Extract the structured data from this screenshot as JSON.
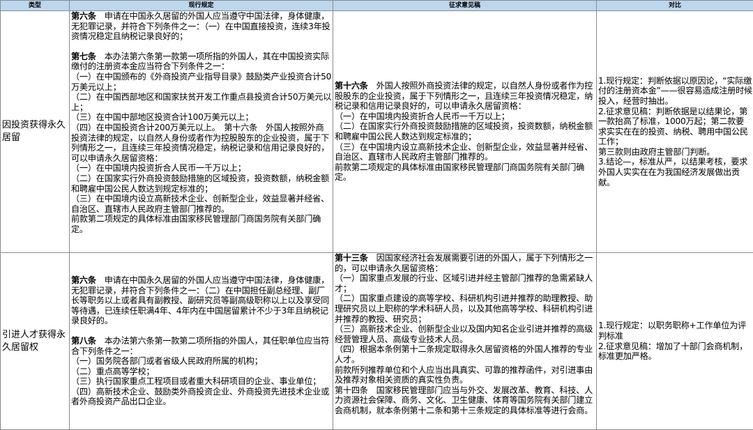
{
  "headers": [
    "类型",
    "现行规定",
    "征求意见稿",
    "对比"
  ],
  "rows": [
    {
      "type": "因投资获得永久居留",
      "current": [
        {
          "art": "第六条",
          "text": "　申请在中国永久居留的外国人应当遵守中国法律，身体健康，无犯罪记录，并符合下列条件之一：（一）在中国直接投资，连续3年投资情况稳定且纳税记录良好的；"
        },
        {
          "art": "第七条",
          "text": "　本办法第六条第一款第一项所指的外国人，其在中国投资实际缴付的注册资本金应当符合下列条件之一：\n（一）在中国颁布的《外商投资产业指导目录》鼓励类产业投资合计50万美元以上；\n（二）在中国西部地区和国家扶贫开发工作重点县投资合计50万美元以上；\n（三）在中国中部地区投资合计100万美元以上；\n（四）在中国投资合计200万美元以上。　第十六条　外国人按照外商投资法律的规定，以自然人身份或者作为控股股东的企业投资，属于下列情形之一，且连续三年投资情况稳定，纳税记录和信用记录良好的，可以申请永久居留资格：\n（一）在中国境内投资折合人民币一千万以上；\n（二）在国家实行外商投资鼓励措施的区域投资，投资数额，纳税金额和聘雇中国公民人数达到规定标准的；\n（三）在中国境内设立高新技术企业、创新型企业，效益显著并经省、自治区、直辖市人民政府主管部门推荐的。\n前款第二项规定的具体标准由国家移民管理部门商国务院有关部门确定。"
        }
      ],
      "draft": [
        {
          "art": "第十六条",
          "text": "　外国人按照外商投资法律的规定，以自然人身份或者作为控股股东的企业投资，属于下列情形之一，且连续三年投资情况稳定，纳税记录和信用记录良好的，可以申请永久居留资格：\n（一）在中国境内投资折合人民币一千万以上；\n（二）在国家实行外商投资鼓励措施的区域投资，投资数额，纳税金额和聘雇中国公民人数达到规定标准的；\n（三）在中国境内设立高新技术企业、创新型企业，效益显著并经省、自治区、直辖市人民政府主管部门推荐的。\n前款第二项规定的具体标准由国家移民管理部门商国务院有关部门确定。"
        }
      ],
      "compare": "1.现行规定：判断依据以原因论，“实际缴付的注册资本金”——很容易造成注册时候投入，经营时抽出。\n2.征求意见稿：判断依据是以结果论，第一款抬高了标准，1000万起；第二款要求实实在在的投资、纳税、聘用中国公民工作；\n第三款则由政府主管部门判断。\n3.结论—，标准从严，以结果考核，要求外国人实实在在为我国经济发展做出贡献。"
    },
    {
      "type": "引进人才获得永久居留权",
      "current": [
        {
          "art": "第六条",
          "text": "　申请在中国永久居留的外国人应当遵守中国法律，身体健康，无犯罪记录，并符合下列条件之一：（二）在中国担任副总经理、副厂长等职务以上或者具有副教授、副研究员等副高级职称以上以及享受同等待遇，已连续任职满4年、4年内在中国居留累计不少于3年且纳税记录良好的。"
        },
        {
          "art": "第八条",
          "text": "　本办法第六条第一款第二项所指的外国人，其任职单位应当符合下列条件之一：\n（一）国务院各部门或者省级人民政府所属的机构；\n（二）重点高等学校；\n（三）执行国家重点工程项目或者重大科研项目的企业、事业单位；\n（四）高新技术企业、鼓励类外商投资企业、外商投资先进技术企业或者外商投资产品出口企业。"
        }
      ],
      "draft": [
        {
          "art": "第十三条",
          "text": "　因国家经济社会发展需要引进的外国人，属于下列情形之一的，可以申请永久居留资格：\n（一）国家重点发展的行业、区域引进并经主管部门推荐的急需紧缺人才；\n（二）国家重点建设的高等学校、科研机构引进并推荐的助理教授、助理研究员以上职称的学术科研人员，以及其他高等学校、科研机构引进并推荐的教授、研究员；\n（三）高新技术企业、创新型企业以及国内知名企业引进并推荐的高级经营管理人员、高级专业技术人员。\n（四）根据本条例第十二条规定取得永久居留资格的外国人推荐的专业人才。\n前款所列推荐单位和个人应当出具真实、可靠的推荐函件，对引进事由及推荐对象相关资质的真实性负责。\n第十四条　国家移民管理部门应当与外交、发展改革、教育、科技、人力资源社会保障、商务、文化、卫生健康、体育等国务院有关部门建立会商机制，就本条例第十二条和第十三条规定的具体标准等进行会商。"
        }
      ],
      "compare": "1.现行规定：以职务职称+工作单位为评判标准\n2.征求意见稿：增加了十部门会商机制，标准更加严格。"
    }
  ]
}
